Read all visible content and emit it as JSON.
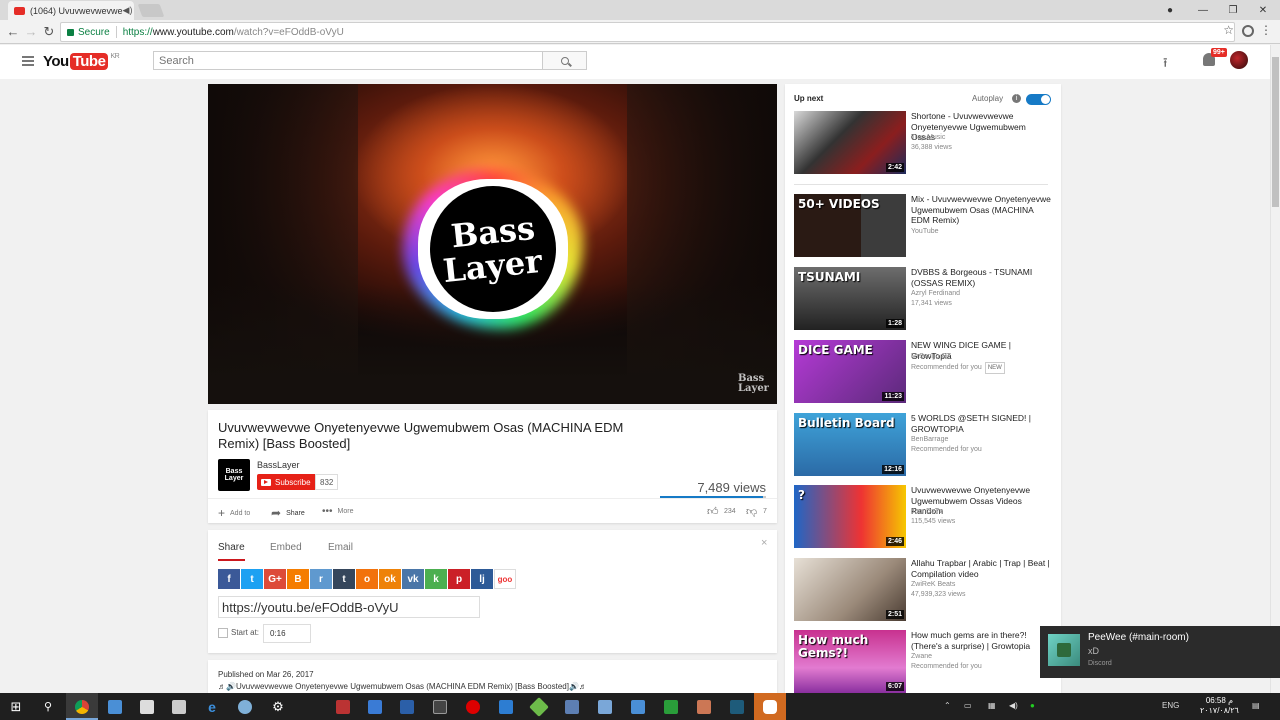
{
  "browser": {
    "tab_title": "(1064) Uvuvwevwevwe",
    "secure_label": "Secure",
    "url_scheme": "https://",
    "url_host": "www.youtube.com",
    "url_path": "/watch?v=eFOddB-oVyU"
  },
  "masthead": {
    "logo_you": "You",
    "logo_tube": "Tube",
    "region": "KR",
    "search_placeholder": "Search",
    "notification_count": "99+"
  },
  "player": {
    "logo_line1": "Bass",
    "logo_line2": "Layer",
    "watermark_line1": "Bass",
    "watermark_line2": "Layer"
  },
  "video": {
    "title": "Uvuvwevwevwe Onyetenyevwe Ugwemubwem Osas (MACHINA EDM Remix) [Bass Boosted]",
    "channel_name": "BassLayer",
    "channel_avatar_text": "Bass Layer",
    "subscribe_label": "Subscribe",
    "subscriber_count": "832",
    "views": "7,489 views",
    "like_ratio": 0.97,
    "add_to_label": "Add to",
    "share_label": "Share",
    "more_label": "More",
    "likes": "234",
    "dislikes": "7"
  },
  "share_panel": {
    "tabs": [
      "Share",
      "Embed",
      "Email"
    ],
    "active_tab": "Share",
    "close_glyph": "×",
    "networks": [
      {
        "name": "facebook",
        "glyph": "f",
        "color": "#3b5998"
      },
      {
        "name": "twitter",
        "glyph": "t",
        "color": "#1da1f2"
      },
      {
        "name": "google-plus",
        "glyph": "G+",
        "color": "#dd4b39"
      },
      {
        "name": "blogger",
        "glyph": "B",
        "color": "#f57d00"
      },
      {
        "name": "reddit",
        "glyph": "r",
        "color": "#5f99cf"
      },
      {
        "name": "tumblr",
        "glyph": "t",
        "color": "#35465c"
      },
      {
        "name": "ok-ru",
        "glyph": "o",
        "color": "#f2720c"
      },
      {
        "name": "odnoklassniki",
        "glyph": "ok",
        "color": "#ee8208"
      },
      {
        "name": "vk",
        "glyph": "vk",
        "color": "#4a76a8"
      },
      {
        "name": "kakao",
        "glyph": "k",
        "color": "#4caf50"
      },
      {
        "name": "pinterest",
        "glyph": "p",
        "color": "#cb2027"
      },
      {
        "name": "livejournal",
        "glyph": "lj",
        "color": "#2d5a97"
      },
      {
        "name": "goo",
        "glyph": "goo",
        "color": "#ffffff"
      }
    ],
    "short_url": "https://youtu.be/eFOddB-oVyU",
    "start_at_label": "Start at:",
    "start_time": "0:16"
  },
  "description": {
    "published": "Published on Mar 26, 2017",
    "first_line": "♬🔊Uvuvwevwevwe Onyetenyevwe Ugwemubwem Osas (MACHINA EDM Remix) [Bass Boosted]🔊♬"
  },
  "sidebar": {
    "up_next_label": "Up next",
    "autoplay_label": "Autoplay",
    "autoplay_on": true,
    "items": [
      {
        "title": "Shortone - Uvuvwevwevwe Onyetenyevwe Ugwemubwem Ossas",
        "channel": "Trap Music",
        "meta": "36,388 views",
        "duration": "2:42",
        "thumb_text": "",
        "thumb_bg": "linear-gradient(135deg,#d9d9d9,#333 40%,#8b1e1e 70%,#1d2b5c)"
      },
      {
        "title": "Mix - Uvuvwevwevwe Onyetenyevwe Ugwemubwem Osas (MACHINA EDM Remix)",
        "channel": "YouTube",
        "meta": "",
        "duration": "",
        "thumb_text": "50+ VIDEOS",
        "thumb_bg": "linear-gradient(90deg,#2a1a14 60%,#3c3c3c 60%)"
      },
      {
        "title": "DVBBS & Borgeous - TSUNAMI (OSSAS REMIX)",
        "channel": "Azryl Ferdinand",
        "meta": "17,341 views",
        "duration": "1:28",
        "thumb_text": "TSUNAMI",
        "thumb_bg": "linear-gradient(180deg,#6d6d6d,#222)"
      },
      {
        "title": "NEW WING DICE GAME | GrowTopia",
        "channel": "MrSongo GT",
        "meta": "Recommended for you",
        "badge": "NEW",
        "duration": "11:23",
        "thumb_text": "DICE GAME",
        "thumb_bg": "linear-gradient(135deg,#b53ad6,#5b2a7a)"
      },
      {
        "title": "5 WORLDS @SETH SIGNED! | GROWTOPIA",
        "channel": "BenBarrage",
        "meta": "Recommended for you",
        "duration": "12:16",
        "thumb_text": "Bulletin Board",
        "thumb_bg": "linear-gradient(180deg,#3fa3d9,#2b6aa6)"
      },
      {
        "title": "Uvuvwevwevwe Onyetenyevwe Ugwemubwem Ossas Videos Random",
        "channel": "JuanDxTv",
        "meta": "115,545 views",
        "duration": "2:46",
        "thumb_text": "?",
        "thumb_bg": "linear-gradient(90deg,#1f66c6,#e33 60%,#f6c700)"
      },
      {
        "title": "Allahu Trapbar | Arabic | Trap | Beat | Compilation video",
        "channel": "ZwiReK Beats",
        "meta": "47,939,323 views",
        "duration": "2:51",
        "thumb_text": "",
        "thumb_bg": "linear-gradient(135deg,#e7e0d6,#9b8a7a 60%,#4a3c32)"
      },
      {
        "title": "How much gems are in there?! (There's a surprise) | Growtopia",
        "channel": "Zwane",
        "meta": "Recommended for you",
        "duration": "6:07",
        "thumb_text": "How much Gems?!",
        "thumb_bg": "linear-gradient(180deg,#c8318f,#e27bd0 60%,#8a2f9f)"
      }
    ]
  },
  "toast": {
    "title": "PeeWee (#main-room)",
    "message": "xD",
    "app": "Discord"
  },
  "taskbar": {
    "lang": "ENG",
    "time": "06:58 م",
    "date": "٢٠١٧/٠٨/٢٦"
  }
}
